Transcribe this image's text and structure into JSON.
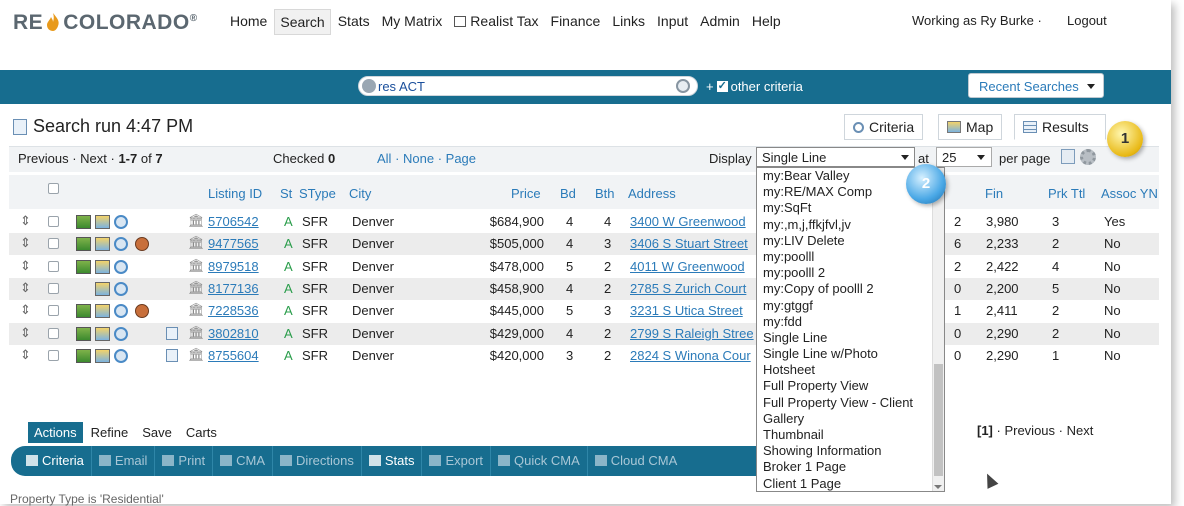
{
  "brand": {
    "logo_left": "RE",
    "logo_right": "COLORADO",
    "reg": "®"
  },
  "nav": [
    {
      "label": "Home"
    },
    {
      "label": "Search",
      "active": true
    },
    {
      "label": "Stats"
    },
    {
      "label": "My Matrix"
    },
    {
      "label": "Realist Tax",
      "icon": "printer-icon"
    },
    {
      "label": "Finance"
    },
    {
      "label": "Links"
    },
    {
      "label": "Input"
    },
    {
      "label": "Admin"
    },
    {
      "label": "Help"
    }
  ],
  "user": {
    "working_as": "Working as Ry Burke ·",
    "logout": "Logout"
  },
  "search": {
    "query": "res ACT",
    "other_criteria": "other criteria",
    "recent_searches": "Recent Searches"
  },
  "page": {
    "title": "Search run 4:47 PM"
  },
  "tabs": {
    "criteria": "Criteria",
    "map": "Map",
    "results": "Results"
  },
  "controls": {
    "previous": "Previous",
    "next": "Next",
    "range": "1-7",
    "of": "of",
    "total": "7",
    "checked_label": "Checked",
    "checked_count": "0",
    "all": "All",
    "none": "None",
    "page": "Page",
    "display_label": "Display",
    "display_value": "Single Line",
    "at_label": "at",
    "at_value": "25",
    "per_page": "per page"
  },
  "columns": {
    "listing_id": "Listing ID",
    "st": "St",
    "stype": "SType",
    "city": "City",
    "price": "Price",
    "bd": "Bd",
    "bth": "Bth",
    "address": "Address",
    "fin": "Fin",
    "prk_ttl": "Prk Ttl",
    "assoc": "Assoc YN"
  },
  "rows": [
    {
      "id": "5706542",
      "st": "A",
      "stype": "SFR",
      "city": "Denver",
      "price": "$684,900",
      "bd": "4",
      "bth": "4",
      "address": "3400 W Greenwood",
      "hidden": "2",
      "fin": "3,980",
      "prk": "3",
      "assoc": "Yes"
    },
    {
      "id": "9477565",
      "st": "A",
      "stype": "SFR",
      "city": "Denver",
      "price": "$505,000",
      "bd": "4",
      "bth": "3",
      "address": "3406 S Stuart Street",
      "hidden": "6",
      "fin": "2,233",
      "prk": "2",
      "assoc": "No"
    },
    {
      "id": "8979518",
      "st": "A",
      "stype": "SFR",
      "city": "Denver",
      "price": "$478,000",
      "bd": "5",
      "bth": "2",
      "address": "4011 W Greenwood",
      "hidden": "2",
      "fin": "2,422",
      "prk": "4",
      "assoc": "No"
    },
    {
      "id": "8177136",
      "st": "A",
      "stype": "SFR",
      "city": "Denver",
      "price": "$458,900",
      "bd": "4",
      "bth": "2",
      "address": "2785 S Zurich Court",
      "hidden": "0",
      "fin": "2,200",
      "prk": "5",
      "assoc": "No"
    },
    {
      "id": "7228536",
      "st": "A",
      "stype": "SFR",
      "city": "Denver",
      "price": "$445,000",
      "bd": "5",
      "bth": "3",
      "address": "3231 S Utica Street",
      "hidden": "1",
      "fin": "2,411",
      "prk": "2",
      "assoc": "No"
    },
    {
      "id": "3802810",
      "st": "A",
      "stype": "SFR",
      "city": "Denver",
      "price": "$429,000",
      "bd": "4",
      "bth": "2",
      "address": "2799 S Raleigh Stree",
      "hidden": "0",
      "fin": "2,290",
      "prk": "2",
      "assoc": "No"
    },
    {
      "id": "8755604",
      "st": "A",
      "stype": "SFR",
      "city": "Denver",
      "price": "$420,000",
      "bd": "3",
      "bth": "2",
      "address": "2824 S Winona Cour",
      "hidden": "0",
      "fin": "2,290",
      "prk": "1",
      "assoc": "No"
    }
  ],
  "display_options": [
    "my:Bear Valley",
    "my:RE/MAX Comp",
    "my:SqFt",
    "my:,m,j,ffkjfvl,jv",
    "my:LIV Delete",
    "my:poolll",
    "my:poolll 2",
    "my:Copy of poolll 2",
    "my:gtggf",
    "my:fdd",
    "Single Line",
    "Single Line w/Photo",
    "Hotsheet",
    "Full Property View",
    "Full Property View - Client",
    "Gallery",
    "Thumbnail",
    "Showing Information",
    "Broker 1 Page",
    "Client 1 Page"
  ],
  "badges": {
    "one": "1",
    "two": "2"
  },
  "actions": [
    "Actions",
    "Refine",
    "Save",
    "Carts"
  ],
  "bottom_pager": {
    "current": "[1]",
    "previous": "· Previous ·",
    "next": "Next"
  },
  "toolbar": [
    "Criteria",
    "Email",
    "Print",
    "CMA",
    "Directions",
    "Stats",
    "Export",
    "Quick CMA",
    "Cloud CMA"
  ],
  "footer_note": "Property Type is 'Residential'",
  "colors": {
    "brand_blue": "#176d8f",
    "link": "#2b7bb9",
    "status_green": "#2a9d4b"
  }
}
